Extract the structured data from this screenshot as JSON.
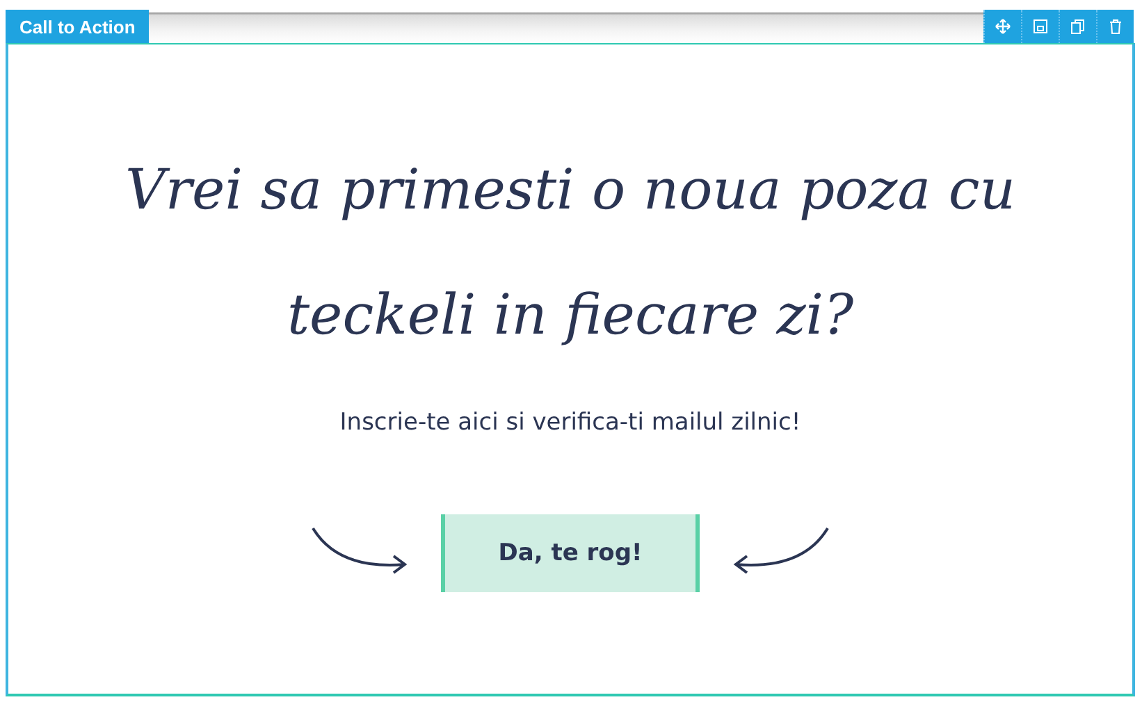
{
  "widget": {
    "label": "Call to Action"
  },
  "toolbar": [
    {
      "kind": "move"
    },
    {
      "kind": "save"
    },
    {
      "kind": "copy"
    },
    {
      "kind": "delete"
    }
  ],
  "heading": "Vrei sa primesti o noua poza cu teckeli in fiecare zi?",
  "subtitle": "Inscrie-te aici si verifica-ti mailul zilnic!",
  "button": {
    "label": "Da, te rog!"
  }
}
